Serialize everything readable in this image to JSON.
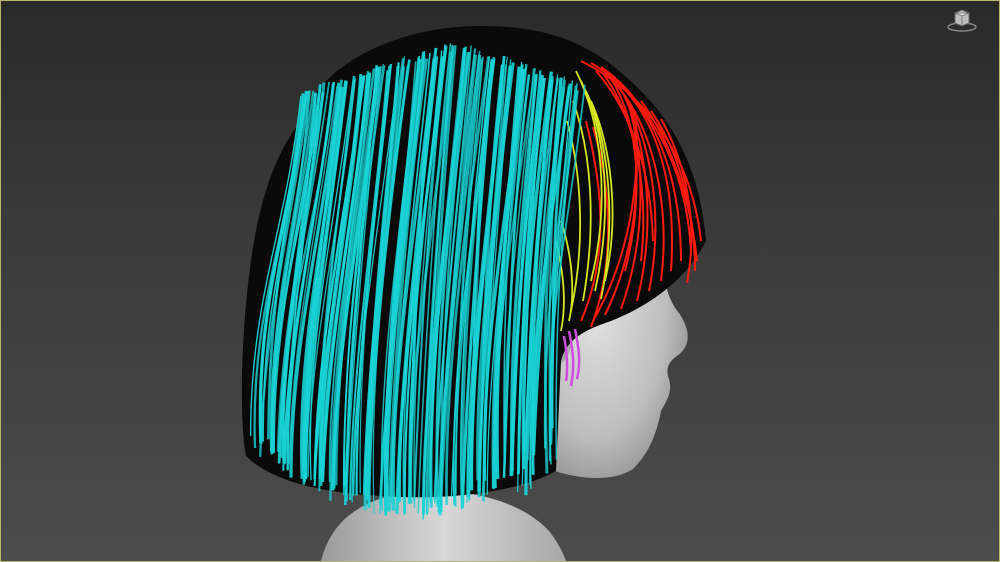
{
  "viewport": {
    "background_top": "#2a2a2a",
    "background_bottom": "#4c4c4c",
    "border_color": "#b7b86a"
  },
  "scene": {
    "object": "hair-strands-on-head-model",
    "strand_groups": [
      {
        "name": "back-hair",
        "color": "#19d3d6"
      },
      {
        "name": "top-hair",
        "color": "#d6e620"
      },
      {
        "name": "bangs",
        "color": "#ff1a10"
      },
      {
        "name": "sideburn",
        "color": "#d04ce0"
      }
    ],
    "head_color": "#c9c9c9"
  },
  "icons": {
    "viewcube": "viewcube-icon"
  }
}
